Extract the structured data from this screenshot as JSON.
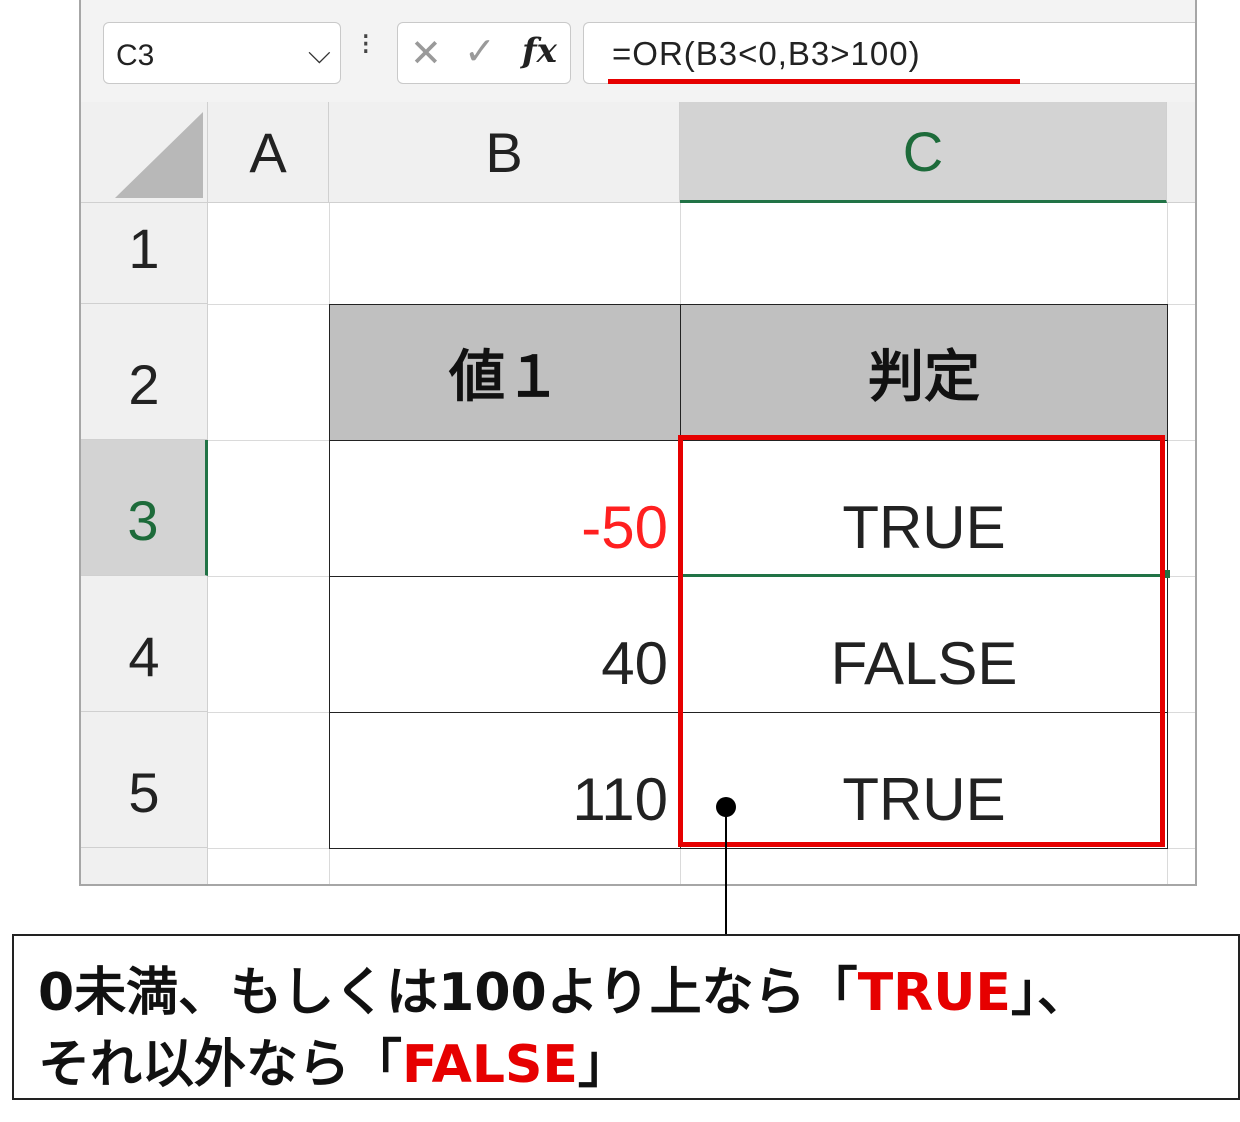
{
  "formula_bar": {
    "name_box": "C3",
    "name_box_arrow": "⌵",
    "dots": "⁝",
    "cancel_icon": "✕",
    "enter_icon": "✓",
    "fx_label": "fx",
    "formula": "=OR(B3<0,B3>100)"
  },
  "columns": [
    "A",
    "B",
    "C"
  ],
  "rows": [
    "1",
    "2",
    "3",
    "4",
    "5"
  ],
  "table": {
    "header_value": "値１",
    "header_result": "判定",
    "rows": [
      {
        "value": "-50",
        "result": "TRUE"
      },
      {
        "value": "40",
        "result": "FALSE"
      },
      {
        "value": "110",
        "result": "TRUE"
      }
    ]
  },
  "callout": {
    "line1_a": "0未満、もしくは100より上なら「",
    "line1_hl": "TRUE",
    "line1_b": "」、",
    "line2_a": "それ以外なら「",
    "line2_hl": "FALSE",
    "line2_b": "」"
  },
  "colors": {
    "accent_green": "#217346",
    "highlight_red": "#e60000",
    "negative_red": "#ff2020",
    "header_gray": "#c0c0c0"
  }
}
